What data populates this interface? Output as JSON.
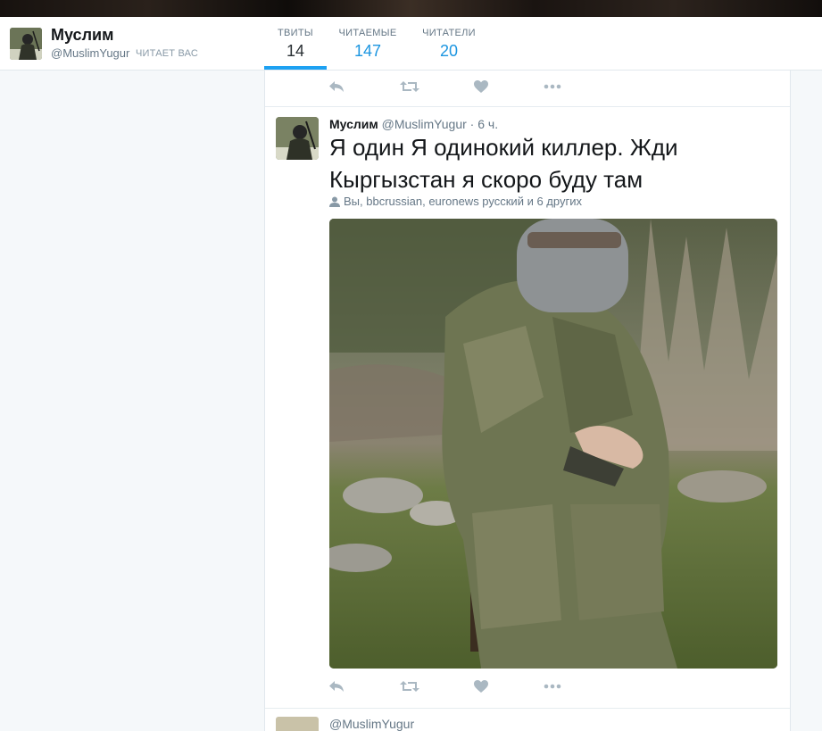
{
  "profile": {
    "name": "Муслим",
    "handle": "@MuslimYugur",
    "follows_you": "ЧИТАЕТ ВАС"
  },
  "stats": [
    {
      "label": "ТВИТЫ",
      "value": "14",
      "active": true
    },
    {
      "label": "ЧИТАЕМЫЕ",
      "value": "147",
      "active": false
    },
    {
      "label": "ЧИТАТЕЛИ",
      "value": "20",
      "active": false
    }
  ],
  "tweet": {
    "name": "Муслим",
    "handle": "@MuslimYugur",
    "separator": "·",
    "time": "6 ч.",
    "text": "Я один Я одинокий киллер. Жди Кыргызстан я скоро буду там",
    "mentions": "Вы, bbcrussian, euronews русский и 6 других"
  },
  "next_tweet": {
    "handle": "@MuslimYugur"
  },
  "actions": [
    "reply-icon",
    "retweet-icon",
    "like-icon",
    "more-icon"
  ],
  "colors": {
    "accent": "#1da1f2",
    "link": "#1b95e0",
    "muted": "#657786",
    "icon": "#aab8c2",
    "background": "#f5f8fa"
  }
}
